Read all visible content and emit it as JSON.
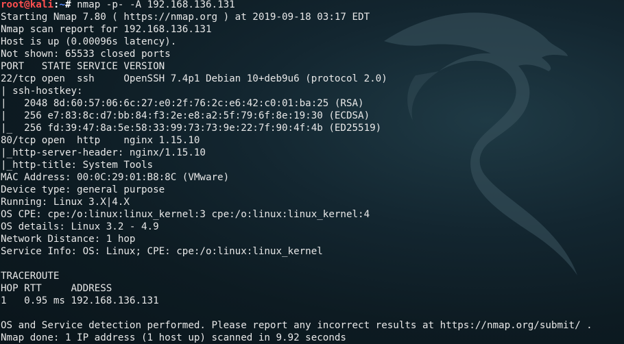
{
  "terminal": {
    "background_color": "#0d1b22",
    "text_color": "#e8e8e8",
    "prompt": {
      "user": "root",
      "at": "@",
      "host": "kali",
      "colon": ":",
      "path": "~",
      "symbol": "# ",
      "command": "nmap -p- -A 192.168.136.131",
      "user_color": "#ff4f4f",
      "path_color": "#5a8cff"
    },
    "lines": [
      "Starting Nmap 7.80 ( https://nmap.org ) at 2019-09-18 03:17 EDT",
      "Nmap scan report for 192.168.136.131",
      "Host is up (0.00096s latency).",
      "Not shown: 65533 closed ports",
      "PORT   STATE SERVICE VERSION",
      "22/tcp open  ssh     OpenSSH 7.4p1 Debian 10+deb9u6 (protocol 2.0)",
      "| ssh-hostkey: ",
      "|   2048 8d:60:57:06:6c:27:e0:2f:76:2c:e6:42:c0:01:ba:25 (RSA)",
      "|   256 e7:83:8c:d7:bb:84:f3:2e:e8:a2:5f:79:6f:8e:19:30 (ECDSA)",
      "|_  256 fd:39:47:8a:5e:58:33:99:73:73:9e:22:7f:90:4f:4b (ED25519)",
      "80/tcp open  http    nginx 1.15.10",
      "|_http-server-header: nginx/1.15.10",
      "|_http-title: System Tools",
      "MAC Address: 00:0C:29:01:B8:8C (VMware)",
      "Device type: general purpose",
      "Running: Linux 3.X|4.X",
      "OS CPE: cpe:/o:linux:linux_kernel:3 cpe:/o:linux:linux_kernel:4",
      "OS details: Linux 3.2 - 4.9",
      "Network Distance: 1 hop",
      "Service Info: OS: Linux; CPE: cpe:/o:linux:linux_kernel",
      "",
      "TRACEROUTE",
      "HOP RTT     ADDRESS",
      "1   0.95 ms 192.168.136.131",
      "",
      "OS and Service detection performed. Please report any incorrect results at https://nmap.org/submit/ .",
      "Nmap done: 1 IP address (1 host up) scanned in 9.92 seconds"
    ]
  }
}
